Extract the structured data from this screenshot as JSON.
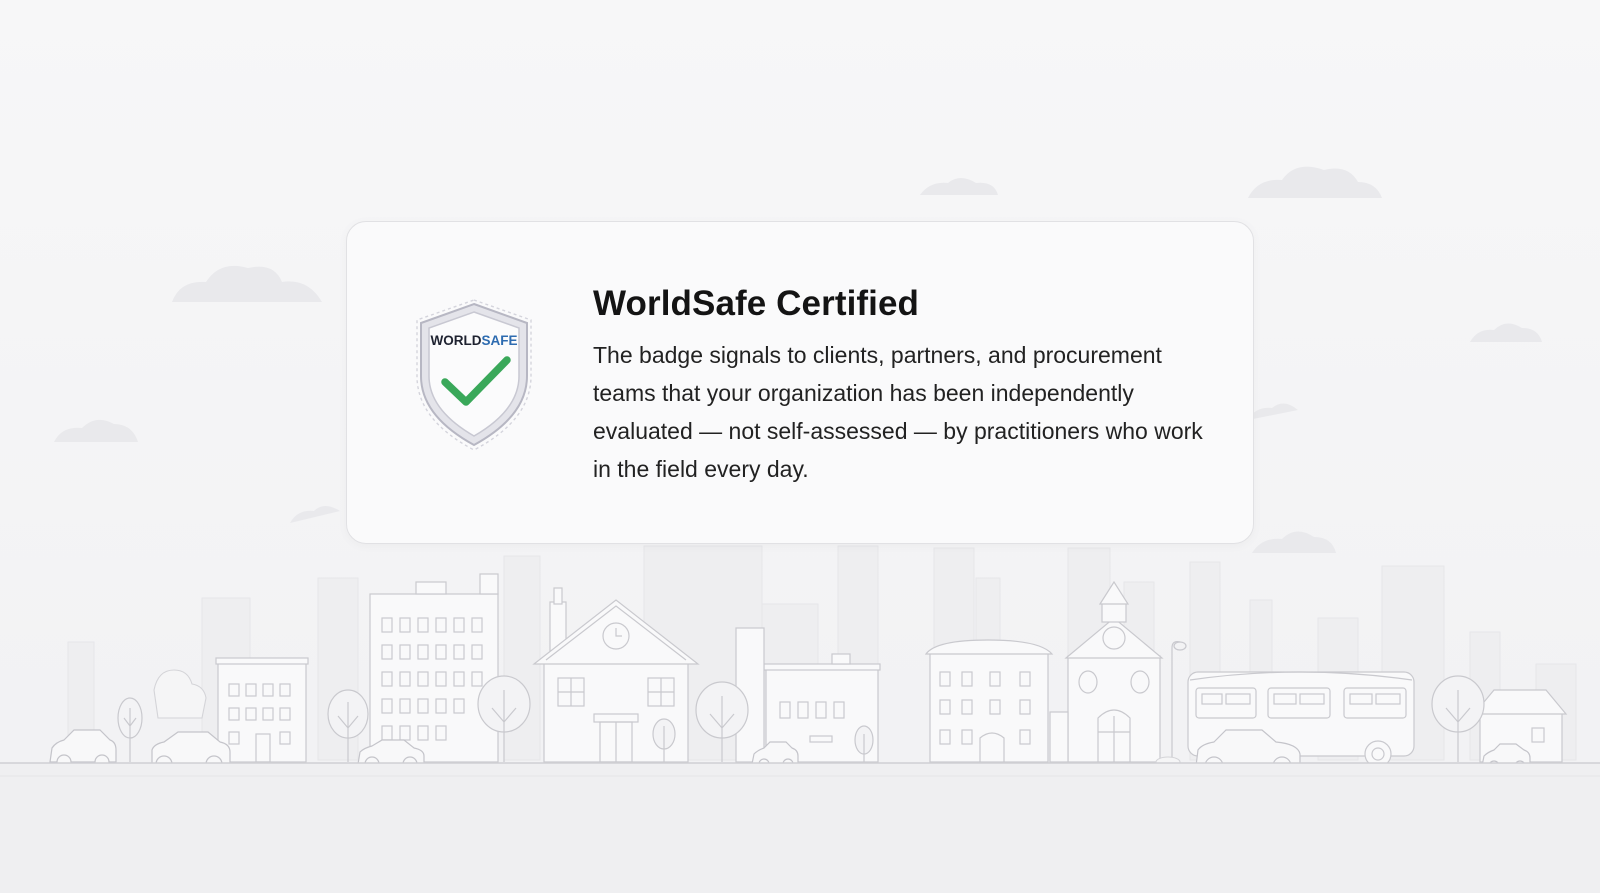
{
  "card": {
    "title": "WorldSafe Certified",
    "body": "The badge signals to clients, partners, and procurement teams that your organization has been independently evaluated — not self-assessed — by practitioners who work in the field every day."
  },
  "badge": {
    "text_part1": "WORLD",
    "text_part2": "SAFE",
    "icon": "shield-check-icon"
  },
  "colors": {
    "background": "#f6f6f7",
    "card_background": "#fafafb",
    "title": "#141414",
    "body_text": "#222222",
    "badge_dark": "#1e2230",
    "badge_blue": "#2d6bb0",
    "check_green": "#3aa85a",
    "illustration_line": "#c9c9ce"
  }
}
